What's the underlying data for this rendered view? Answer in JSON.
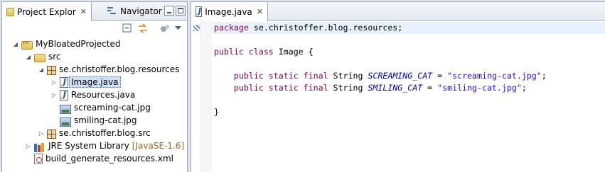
{
  "left_view": {
    "tabs": [
      {
        "label": "Project Explor",
        "icon": "project-explorer-icon",
        "active": true
      },
      {
        "label": "Navigator",
        "icon": "navigator-icon",
        "active": false
      }
    ],
    "close_glyph": "✕"
  },
  "tree": [
    {
      "label": "MyBloatedProjected",
      "icon": "project-folder-icon",
      "depth": 0,
      "expanded": true
    },
    {
      "label": "src",
      "icon": "source-folder-icon",
      "depth": 1,
      "expanded": true
    },
    {
      "label": "se.christoffer.blog.resources",
      "icon": "package-icon",
      "depth": 2,
      "expanded": true
    },
    {
      "label": "Image.java",
      "icon": "java-file-icon",
      "depth": 3,
      "expanded": false,
      "selected": true
    },
    {
      "label": "Resources.java",
      "icon": "java-file-icon",
      "depth": 3,
      "expanded": false
    },
    {
      "label": "screaming-cat.jpg",
      "icon": "image-file-icon",
      "depth": 3
    },
    {
      "label": "smiling-cat.jpg",
      "icon": "image-file-icon",
      "depth": 3
    },
    {
      "label": "se.christoffer.blog.src",
      "icon": "package-icon",
      "depth": 2,
      "expanded": false
    },
    {
      "label": "JRE System Library",
      "decor": "[JavaSE-1.6]",
      "icon": "library-icon",
      "depth": 1,
      "expanded": false
    },
    {
      "label": "build_generate_resources.xml",
      "icon": "xml-file-icon",
      "depth": 1
    }
  ],
  "editor": {
    "tab_label": "Image.java",
    "close_glyph": "✕",
    "lines": [
      [
        {
          "t": "package",
          "c": "kw"
        },
        {
          "t": " se.christoffer.blog.resources;",
          "c": ""
        }
      ],
      [],
      [
        {
          "t": "public",
          "c": "kw"
        },
        {
          "t": " ",
          "c": ""
        },
        {
          "t": "class",
          "c": "kw"
        },
        {
          "t": " Image {",
          "c": ""
        }
      ],
      [],
      [
        {
          "t": "    ",
          "c": ""
        },
        {
          "t": "public",
          "c": "kw"
        },
        {
          "t": " ",
          "c": ""
        },
        {
          "t": "static",
          "c": "kw"
        },
        {
          "t": " ",
          "c": ""
        },
        {
          "t": "final",
          "c": "kw"
        },
        {
          "t": " String ",
          "c": ""
        },
        {
          "t": "SCREAMING_CAT",
          "c": "const"
        },
        {
          "t": " = ",
          "c": ""
        },
        {
          "t": "\"screaming-cat.jpg\"",
          "c": "str"
        },
        {
          "t": ";",
          "c": ""
        }
      ],
      [
        {
          "t": "    ",
          "c": ""
        },
        {
          "t": "public",
          "c": "kw"
        },
        {
          "t": " ",
          "c": ""
        },
        {
          "t": "static",
          "c": "kw"
        },
        {
          "t": " ",
          "c": ""
        },
        {
          "t": "final",
          "c": "kw"
        },
        {
          "t": " String ",
          "c": ""
        },
        {
          "t": "SMILING_CAT",
          "c": "const"
        },
        {
          "t": " = ",
          "c": ""
        },
        {
          "t": "\"smiling-cat.jpg\"",
          "c": "str"
        },
        {
          "t": ";",
          "c": ""
        }
      ],
      [],
      [
        {
          "t": "}",
          "c": ""
        }
      ]
    ]
  },
  "colors": {
    "keyword": "#7f0055",
    "constant": "#0000c0",
    "string": "#2a00ff",
    "selection": "#cfe0f7",
    "library_decoration": "#96691e"
  }
}
